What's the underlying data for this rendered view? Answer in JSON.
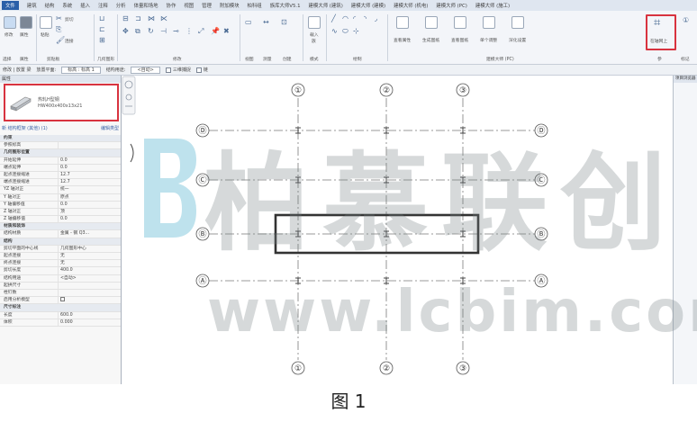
{
  "menubar": {
    "items": [
      "文件",
      "建筑",
      "结构",
      "系统",
      "插入",
      "注释",
      "分析",
      "体量和场地",
      "协作",
      "视图",
      "管理",
      "附加模块",
      "柏科组",
      "族库大师V5.1",
      "建模大师 (建筑)",
      "建模大师 (建模)",
      "建模大师 (机电)",
      "建模大师 (PC)",
      "建模大师 (施工)"
    ]
  },
  "ribbon": {
    "modify_label": "修改",
    "paste_label": "粘贴",
    "cut_label": "剪切",
    "join_label": "连接",
    "panels": [
      "选择",
      "属性",
      "剪贴板",
      "几何图形",
      "修改",
      "视图",
      "测量",
      "创建",
      "模式",
      "绘制",
      "建模大师 (PC)",
      "参",
      "标记"
    ],
    "tools": {
      "load_label": "载入",
      "family_label": "族",
      "view_props_label": "查看属性",
      "gen_section_label": "生成图纸",
      "view_section_label": "查看图纸",
      "single_label": "单个调整",
      "section_setting_label": "深化设置",
      "on_axis_label": "在轴网上",
      "identify_label": "①"
    }
  },
  "optbar": {
    "mode": "修改 | 放置 梁",
    "plane_label": "放置平面:",
    "plane_value": "标高 : 标高 1",
    "usage_label": "结构用途:",
    "usage_value": "<自动>",
    "chain_label": "三维捕捉",
    "link_label": "链"
  },
  "props": {
    "header": "属性",
    "type_name": "热轧H型钢",
    "type_size": "HW400x400x13x21",
    "filter_label": "新 结构框架 (其他) (1)",
    "edit_type_label": "编辑类型",
    "rows": [
      {
        "k": "约束",
        "v": "",
        "group": true
      },
      {
        "k": "参照标高",
        "v": ""
      },
      {
        "k": "几何图形位置",
        "v": "",
        "group": true
      },
      {
        "k": "开始延伸",
        "v": "0.0"
      },
      {
        "k": "端点延伸",
        "v": "0.0"
      },
      {
        "k": "起点连接缩进",
        "v": "12.7"
      },
      {
        "k": "端点连接缩进",
        "v": "12.7"
      },
      {
        "k": "YZ 轴对正",
        "v": "统一"
      },
      {
        "k": "Y 轴对正",
        "v": "原点"
      },
      {
        "k": "Y 轴偏移值",
        "v": "0.0"
      },
      {
        "k": "Z 轴对正",
        "v": "顶"
      },
      {
        "k": "Z 轴偏移值",
        "v": "0.0"
      },
      {
        "k": "材质和装饰",
        "v": "",
        "group": true
      },
      {
        "k": "结构材质",
        "v": "金属 - 钢 Q3..."
      },
      {
        "k": "结构",
        "v": "",
        "group": true
      },
      {
        "k": "剪切平面的中心线",
        "v": "几何图形中心"
      },
      {
        "k": "起点连接",
        "v": "无"
      },
      {
        "k": "终点连接",
        "v": "无"
      },
      {
        "k": "剪切长度",
        "v": "400.0"
      },
      {
        "k": "结构用途",
        "v": "<自动>"
      },
      {
        "k": "起拱尺寸",
        "v": ""
      },
      {
        "k": "栓钉数",
        "v": ""
      },
      {
        "k": "启用分析模型",
        "v": "check"
      },
      {
        "k": "尺寸标注",
        "v": "",
        "group": true
      },
      {
        "k": "长度",
        "v": "600.0"
      },
      {
        "k": "体积",
        "v": "0.000"
      }
    ]
  },
  "canvas": {
    "grid_top": [
      "①",
      "②",
      "③"
    ],
    "grid_bottom": [
      "①",
      "②",
      "③"
    ],
    "grid_left": [
      "Ⓓ",
      "Ⓒ",
      "Ⓑ",
      "Ⓐ"
    ],
    "grid_right": [
      "Ⓓ",
      "Ⓒ",
      "Ⓑ",
      "Ⓐ"
    ]
  },
  "browser": {
    "header": "项目浏览器"
  },
  "watermark": {
    "cn": "柏慕联创",
    "url": "www.lcbim.com"
  },
  "caption": "图 1"
}
